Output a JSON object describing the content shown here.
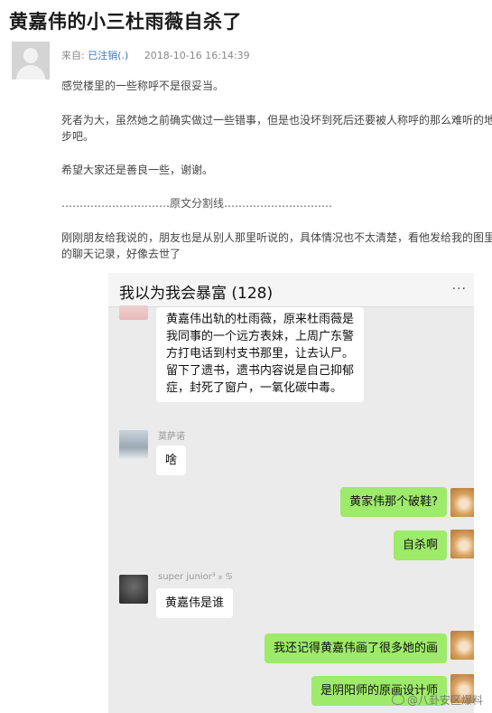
{
  "post": {
    "title": "黄嘉伟的小三杜雨薇自杀了",
    "meta_prefix": "来自:",
    "user": "已注销(.)",
    "timestamp": "2018-10-16 16:14:39",
    "paragraphs": [
      "感觉楼里的一些称呼不是很妥当。",
      "死者为大，虽然她之前确实做过一些错事，但是也没坏到死后还要被人称呼的那么难听的地",
      "步吧。",
      "希望大家还是善良一些，谢谢。",
      "…………………………原文分割线…………………………",
      "刚刚朋友给我说的，朋友也是从别人那里听说的，具体情况也不太清楚，看他发给我的图里",
      "的聊天记录，好像去世了"
    ]
  },
  "chat": {
    "title": "我以为我会暴富 (128)",
    "menu": "···",
    "messages": [
      {
        "side": "left",
        "text": "黄嘉伟出轨的杜雨薇，原来杜雨薇是我同事的一个远方表妹，上周广东警方打电话到村支书那里，让去认尸。留下了遗书，遗书内容说是自己抑郁症，封死了窗户，一氧化碳中毒。"
      },
      {
        "side": "left",
        "sender": "莫萨诺",
        "text": "啥"
      },
      {
        "side": "right",
        "text": "黄家伟那个破鞋?"
      },
      {
        "side": "right",
        "text": "自杀啊"
      },
      {
        "side": "left",
        "sender": "super junior³ ₈ ♋",
        "text": "黄嘉伟是谁"
      },
      {
        "side": "right",
        "text": "我还记得黄嘉伟画了很多她的画"
      },
      {
        "side": "right",
        "text": "是阴阳师的原画设计师"
      }
    ]
  },
  "watermark": "@八卦安区爆料"
}
